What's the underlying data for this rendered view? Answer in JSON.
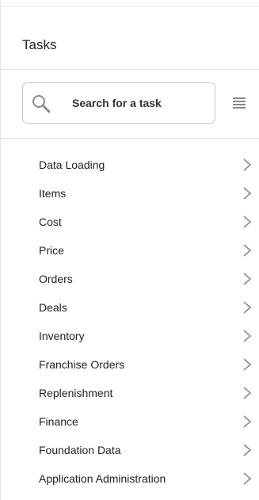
{
  "panel": {
    "title": "Tasks"
  },
  "search": {
    "placeholder": "Search for a task",
    "value": ""
  },
  "icons": {
    "search": "search-icon",
    "list_view": "list-view-icon",
    "chevron": "chevron-right-icon"
  },
  "colors": {
    "text": "#222222",
    "border": "#c9c9c9",
    "icon": "#8a8a8a",
    "divider": "#dddddd"
  },
  "tasks": [
    {
      "label": "Data Loading"
    },
    {
      "label": "Items"
    },
    {
      "label": "Cost"
    },
    {
      "label": "Price"
    },
    {
      "label": "Orders"
    },
    {
      "label": "Deals"
    },
    {
      "label": "Inventory"
    },
    {
      "label": "Franchise Orders"
    },
    {
      "label": "Replenishment"
    },
    {
      "label": "Finance"
    },
    {
      "label": "Foundation Data"
    },
    {
      "label": "Application Administration"
    }
  ]
}
